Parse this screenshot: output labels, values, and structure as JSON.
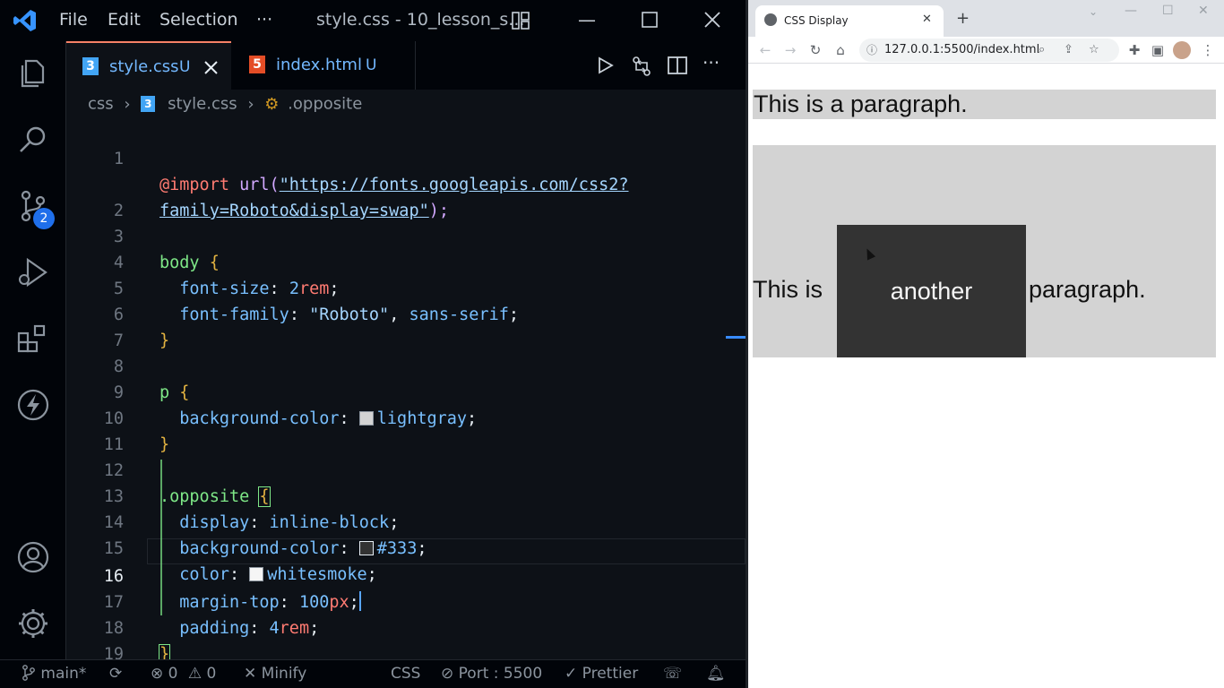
{
  "vscode": {
    "menu": [
      "File",
      "Edit",
      "Selection",
      "···"
    ],
    "window_title": "style.css - 10_lesson_s...",
    "tabs": [
      {
        "name": "style.css",
        "badge": "U"
      },
      {
        "name": "index.html",
        "badge": "U"
      }
    ],
    "breadcrumb": [
      "css",
      "style.css",
      ".opposite"
    ],
    "line_numbers": [
      "1",
      "",
      "2",
      "3",
      "4",
      "5",
      "6",
      "7",
      "8",
      "9",
      "10",
      "11",
      "12",
      "13",
      "14",
      "15",
      "16",
      "17",
      "18",
      "19"
    ],
    "code": {
      "l1a_kw": "@import",
      "l1a_fn": "url(",
      "l1a_str": "\"https://fonts.googleapis.com/css2?",
      "l1b_str": "family=Roboto&display=swap\"",
      "l1b_end": ");",
      "body_sel": "body",
      "open": "{",
      "close": "}",
      "font_size_prop": "font-size",
      "font_size_num": "2",
      "font_size_unit": "rem",
      "font_family_prop": "font-family",
      "font_family_str": "\"Roboto\"",
      "font_family_val": "sans-serif",
      "p_sel": "p",
      "bg_prop": "background-color",
      "bg_p_val": "lightgray",
      "opp_sel": ".opposite",
      "display_prop": "display",
      "display_val": "inline-block",
      "bg_opp_val": "#333",
      "color_prop": "color",
      "color_val": "whitesmoke",
      "mt_prop": "margin-top",
      "mt_num": "100",
      "mt_unit": "px",
      "pad_prop": "padding",
      "pad_num": "4",
      "pad_unit": "rem",
      "colon": ": ",
      "semi": ";",
      "comma": ", "
    },
    "colors": {
      "lightgray": "#d3d3d3",
      "c333": "#333333",
      "whitesmoke": "#f5f5f5"
    },
    "scm_badge": "2",
    "status": {
      "branch": "main*",
      "errors": "0",
      "warnings": "0",
      "minify": "Minify",
      "lang": "CSS",
      "port": "Port : 5500",
      "prettier": "Prettier"
    }
  },
  "chrome": {
    "tab_title": "CSS Display",
    "url": "127.0.0.1:5500/index.html",
    "page": {
      "p1": "This is a paragraph.",
      "p2_before": "This is",
      "p2_span": "another",
      "p2_after": "paragraph."
    }
  }
}
